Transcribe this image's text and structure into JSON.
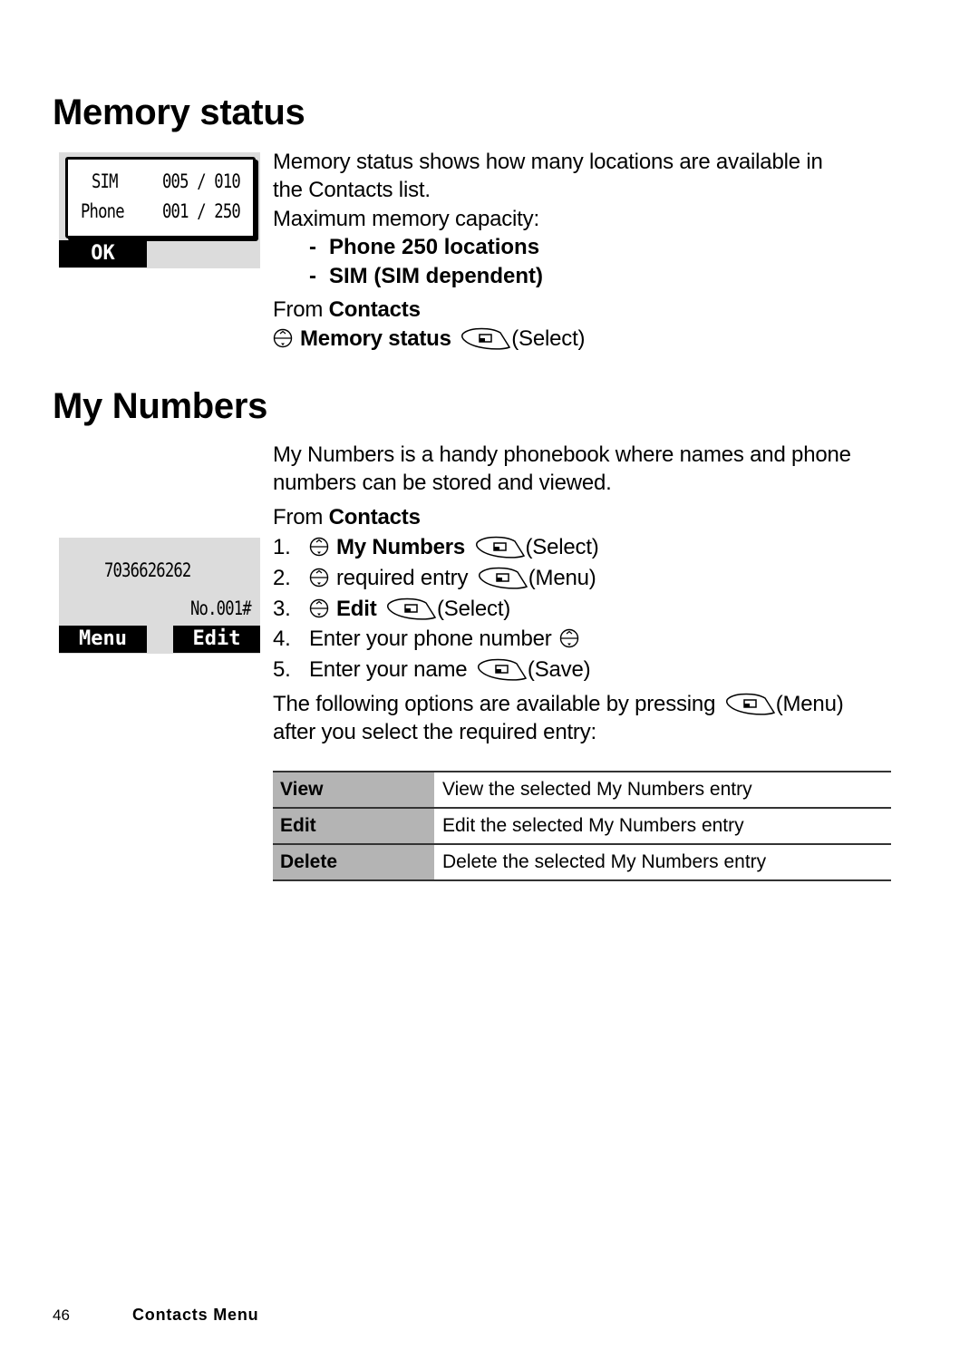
{
  "sections": {
    "memory_status": {
      "title": "Memory status",
      "description_line1": "Memory status shows how many locations are available in",
      "description_line2": "the Contacts list.",
      "capacity_label": "Maximum memory capacity:",
      "bullets": [
        "Phone 250 locations",
        "SIM (SIM dependent)"
      ],
      "from_prefix": "From ",
      "from_menu": "Contacts",
      "nav_item": "Memory status",
      "nav_action": "(Select)",
      "screen": {
        "rows": [
          {
            "label": "SIM",
            "value": "005 / 010"
          },
          {
            "label": "Phone",
            "value": "001 / 250"
          }
        ],
        "softkey_left": "OK"
      }
    },
    "my_numbers": {
      "title": "My Numbers",
      "description_line1": "My Numbers is a handy phonebook where names and phone",
      "description_line2": "numbers can be stored and viewed.",
      "from_prefix": "From ",
      "from_menu": "Contacts",
      "steps": [
        {
          "num": "1.",
          "text": "My Numbers",
          "action": "(Select)"
        },
        {
          "num": "2.",
          "text": "required entry",
          "action": "(Menu)"
        },
        {
          "num": "3.",
          "text": "Edit",
          "action": "(Select)"
        },
        {
          "num": "4.",
          "text": "Enter your phone number"
        },
        {
          "num": "5.",
          "text": "Enter your name",
          "action": "(Save)"
        }
      ],
      "options_intro_line1": "The following options are available by pressing",
      "options_intro_action": "(Menu)",
      "options_intro_line2": "after you select the required entry:",
      "options": [
        {
          "name": "View",
          "description": "View the selected My Numbers entry"
        },
        {
          "name": "Edit",
          "description": "Edit the selected My Numbers entry"
        },
        {
          "name": "Delete",
          "description": "Delete the selected My Numbers entry"
        }
      ],
      "screen": {
        "number": "7036626262",
        "entry_index": "No.001#",
        "softkey_left": "Menu",
        "softkey_right": "Edit"
      }
    }
  },
  "footer": {
    "page_number": "46",
    "chapter": "Contacts Menu"
  },
  "icons": {
    "nav": "navigation-key-icon",
    "softkey": "softkey-icon"
  }
}
